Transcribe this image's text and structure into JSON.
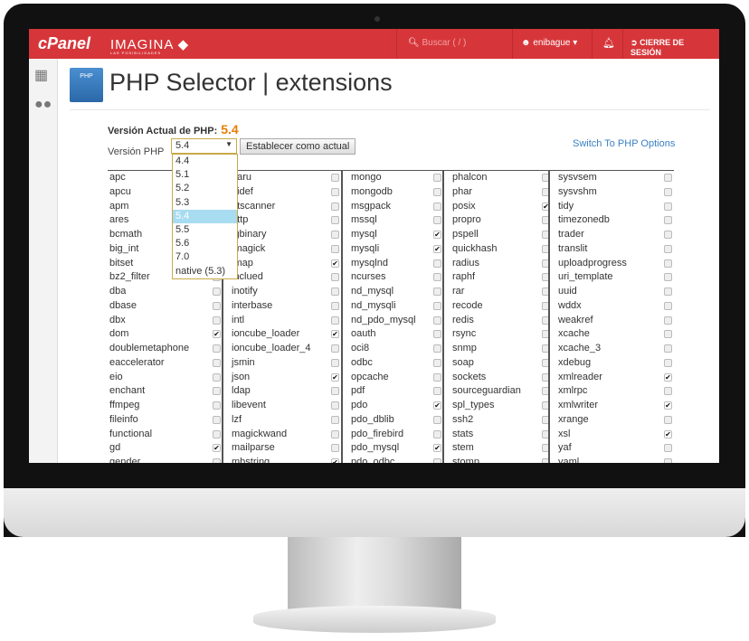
{
  "header": {
    "logo": "cPanel",
    "brand": "IMAGINA",
    "brand_tagline": "LAS POSIBILIDADES",
    "search_placeholder": "Buscar ( / )",
    "user": "enibague",
    "logout": "CIERRE DE SESIÓN"
  },
  "page": {
    "icon_label": "PHP",
    "title": "PHP Selector | extensions",
    "current_label": "Versión Actual de PHP:",
    "current_value": "5.4",
    "version_label": "Versión PHP",
    "selected_version": "5.4",
    "set_button": "Establecer como actual",
    "switch_link": "Switch To PHP Options"
  },
  "dropdown": {
    "options": [
      "4.4",
      "5.1",
      "5.2",
      "5.3",
      "5.4",
      "5.5",
      "5.6",
      "7.0",
      "native (5.3)"
    ],
    "highlighted": "5.4"
  },
  "colors": {
    "header": "#d6363a",
    "accent": "#e87e04",
    "link": "#3a80c3"
  },
  "columns": [
    [
      {
        "n": "apc",
        "c": false
      },
      {
        "n": "apcu",
        "c": false
      },
      {
        "n": "apm",
        "c": false
      },
      {
        "n": "ares",
        "c": false
      },
      {
        "n": "bcmath",
        "c": false
      },
      {
        "n": "big_int",
        "c": false
      },
      {
        "n": "bitset",
        "c": false
      },
      {
        "n": "bz2_filter",
        "c": false
      },
      {
        "n": "dba",
        "c": false
      },
      {
        "n": "dbase",
        "c": false
      },
      {
        "n": "dbx",
        "c": false
      },
      {
        "n": "dom",
        "c": true
      },
      {
        "n": "doublemetaphone",
        "c": false
      },
      {
        "n": "eaccelerator",
        "c": false
      },
      {
        "n": "eio",
        "c": false
      },
      {
        "n": "enchant",
        "c": false
      },
      {
        "n": "ffmpeg",
        "c": false
      },
      {
        "n": "fileinfo",
        "c": false
      },
      {
        "n": "functional",
        "c": false
      },
      {
        "n": "gd",
        "c": true
      },
      {
        "n": "gender",
        "c": false
      }
    ],
    [
      {
        "n": "haru",
        "c": false
      },
      {
        "n": "hidef",
        "c": false
      },
      {
        "n": "htscanner",
        "c": false
      },
      {
        "n": "http",
        "c": false
      },
      {
        "n": "igbinary",
        "c": false
      },
      {
        "n": "imagick",
        "c": false
      },
      {
        "n": "imap",
        "c": true
      },
      {
        "n": "inclued",
        "c": false
      },
      {
        "n": "inotify",
        "c": false
      },
      {
        "n": "interbase",
        "c": false
      },
      {
        "n": "intl",
        "c": false
      },
      {
        "n": "ioncube_loader",
        "c": true
      },
      {
        "n": "ioncube_loader_4",
        "c": false
      },
      {
        "n": "jsmin",
        "c": false
      },
      {
        "n": "json",
        "c": true
      },
      {
        "n": "ldap",
        "c": false
      },
      {
        "n": "libevent",
        "c": false
      },
      {
        "n": "lzf",
        "c": false
      },
      {
        "n": "magickwand",
        "c": false
      },
      {
        "n": "mailparse",
        "c": false
      },
      {
        "n": "mbstring",
        "c": true
      }
    ],
    [
      {
        "n": "mongo",
        "c": false
      },
      {
        "n": "mongodb",
        "c": false
      },
      {
        "n": "msgpack",
        "c": false
      },
      {
        "n": "mssql",
        "c": false
      },
      {
        "n": "mysql",
        "c": true
      },
      {
        "n": "mysqli",
        "c": true
      },
      {
        "n": "mysqlnd",
        "c": false
      },
      {
        "n": "ncurses",
        "c": false
      },
      {
        "n": "nd_mysql",
        "c": false
      },
      {
        "n": "nd_mysqli",
        "c": false
      },
      {
        "n": "nd_pdo_mysql",
        "c": false
      },
      {
        "n": "oauth",
        "c": false
      },
      {
        "n": "oci8",
        "c": false
      },
      {
        "n": "odbc",
        "c": false
      },
      {
        "n": "opcache",
        "c": false
      },
      {
        "n": "pdf",
        "c": false
      },
      {
        "n": "pdo",
        "c": true
      },
      {
        "n": "pdo_dblib",
        "c": false
      },
      {
        "n": "pdo_firebird",
        "c": false
      },
      {
        "n": "pdo_mysql",
        "c": true
      },
      {
        "n": "pdo_odbc",
        "c": false
      }
    ],
    [
      {
        "n": "phalcon",
        "c": false
      },
      {
        "n": "phar",
        "c": false
      },
      {
        "n": "posix",
        "c": true
      },
      {
        "n": "propro",
        "c": false
      },
      {
        "n": "pspell",
        "c": false
      },
      {
        "n": "quickhash",
        "c": false
      },
      {
        "n": "radius",
        "c": false
      },
      {
        "n": "raphf",
        "c": false
      },
      {
        "n": "rar",
        "c": false
      },
      {
        "n": "recode",
        "c": false
      },
      {
        "n": "redis",
        "c": false
      },
      {
        "n": "rsync",
        "c": false
      },
      {
        "n": "snmp",
        "c": false
      },
      {
        "n": "soap",
        "c": false
      },
      {
        "n": "sockets",
        "c": false
      },
      {
        "n": "sourceguardian",
        "c": false
      },
      {
        "n": "spl_types",
        "c": false
      },
      {
        "n": "ssh2",
        "c": false
      },
      {
        "n": "stats",
        "c": false
      },
      {
        "n": "stem",
        "c": false
      },
      {
        "n": "stomp",
        "c": false
      }
    ],
    [
      {
        "n": "sysvsem",
        "c": false
      },
      {
        "n": "sysvshm",
        "c": false
      },
      {
        "n": "tidy",
        "c": false
      },
      {
        "n": "timezonedb",
        "c": false
      },
      {
        "n": "trader",
        "c": false
      },
      {
        "n": "translit",
        "c": false
      },
      {
        "n": "uploadprogress",
        "c": false
      },
      {
        "n": "uri_template",
        "c": false
      },
      {
        "n": "uuid",
        "c": false
      },
      {
        "n": "wddx",
        "c": false
      },
      {
        "n": "weakref",
        "c": false
      },
      {
        "n": "xcache",
        "c": false
      },
      {
        "n": "xcache_3",
        "c": false
      },
      {
        "n": "xdebug",
        "c": false
      },
      {
        "n": "xmlreader",
        "c": true
      },
      {
        "n": "xmlrpc",
        "c": false
      },
      {
        "n": "xmlwriter",
        "c": true
      },
      {
        "n": "xrange",
        "c": false
      },
      {
        "n": "xsl",
        "c": true
      },
      {
        "n": "yaf",
        "c": false
      },
      {
        "n": "yaml",
        "c": false
      }
    ]
  ]
}
